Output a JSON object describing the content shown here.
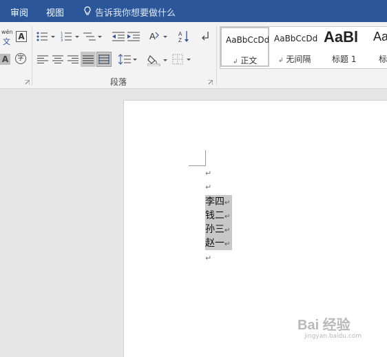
{
  "titlebar": {
    "tabs": [
      "审阅",
      "视图"
    ],
    "tell_me": "告诉我你想要做什么"
  },
  "ribbon": {
    "font_group": {
      "phonetic_guide_label": "wén",
      "phonetic_guide_char": "文",
      "char_border_label": "A",
      "char_shading_label": "A",
      "enclose_char_label": "字"
    },
    "paragraph_group": {
      "label": "段落"
    },
    "styles": [
      {
        "sample": "AaBbCcDd",
        "name": "正文",
        "mark": "↲",
        "selected": true
      },
      {
        "sample": "AaBbCcDd",
        "name": "无间隔",
        "mark": "↲",
        "selected": false
      },
      {
        "sample": "AaBl",
        "name": "标题 1",
        "mark": "",
        "selected": false
      },
      {
        "sample": "Aa",
        "name": "标",
        "mark": "",
        "selected": false
      }
    ]
  },
  "document": {
    "empty_marks": [
      "↵",
      "↵"
    ],
    "lines": [
      "李四",
      "钱二",
      "孙三",
      "赵一"
    ],
    "paragraph_mark": "↵",
    "trailing_mark": "↵"
  },
  "watermark": {
    "main": "Bai 经验",
    "sub": "jingyan.baidu.com"
  },
  "colors": {
    "titlebar": "#2b579a",
    "ribbon": "#f3f3f3",
    "selection": "#c8c8c8",
    "workspace": "#e6e6e6"
  }
}
